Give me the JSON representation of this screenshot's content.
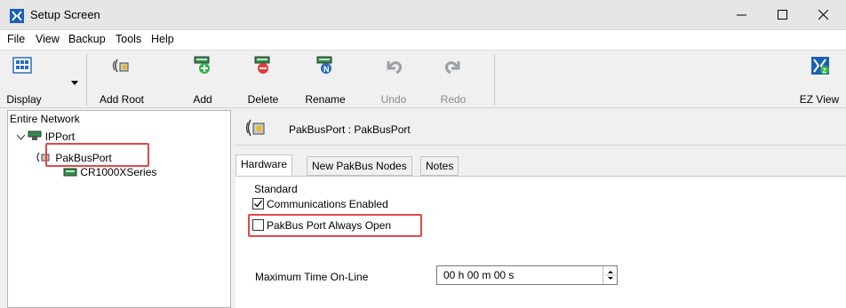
{
  "window": {
    "title": "Setup Screen"
  },
  "menu": [
    "File",
    "View",
    "Backup",
    "Tools",
    "Help"
  ],
  "toolbar": {
    "display": "Display",
    "add_root": "Add Root",
    "add": "Add",
    "delete": "Delete",
    "rename": "Rename",
    "undo": "Undo",
    "redo": "Redo",
    "ez_view": "EZ View"
  },
  "tree": {
    "header": "Entire Network",
    "nodes": [
      {
        "label": "IPPort"
      },
      {
        "label": "PakBusPort"
      },
      {
        "label": "CR1000XSeries"
      }
    ]
  },
  "device": {
    "title": "PakBusPort : PakBusPort"
  },
  "tabs": [
    "Hardware",
    "New PakBus Nodes",
    "Notes"
  ],
  "hardware": {
    "group_label": "Standard",
    "communications_enabled": {
      "label": "Communications Enabled",
      "checked": true
    },
    "port_always_open": {
      "label": "PakBus Port Always Open",
      "checked": false
    },
    "max_time_label": "Maximum Time On-Line",
    "max_time_value": "00 h 00 m 00 s"
  },
  "colors": {
    "highlight": "#e0474c",
    "accent": "#1a5fb4"
  }
}
